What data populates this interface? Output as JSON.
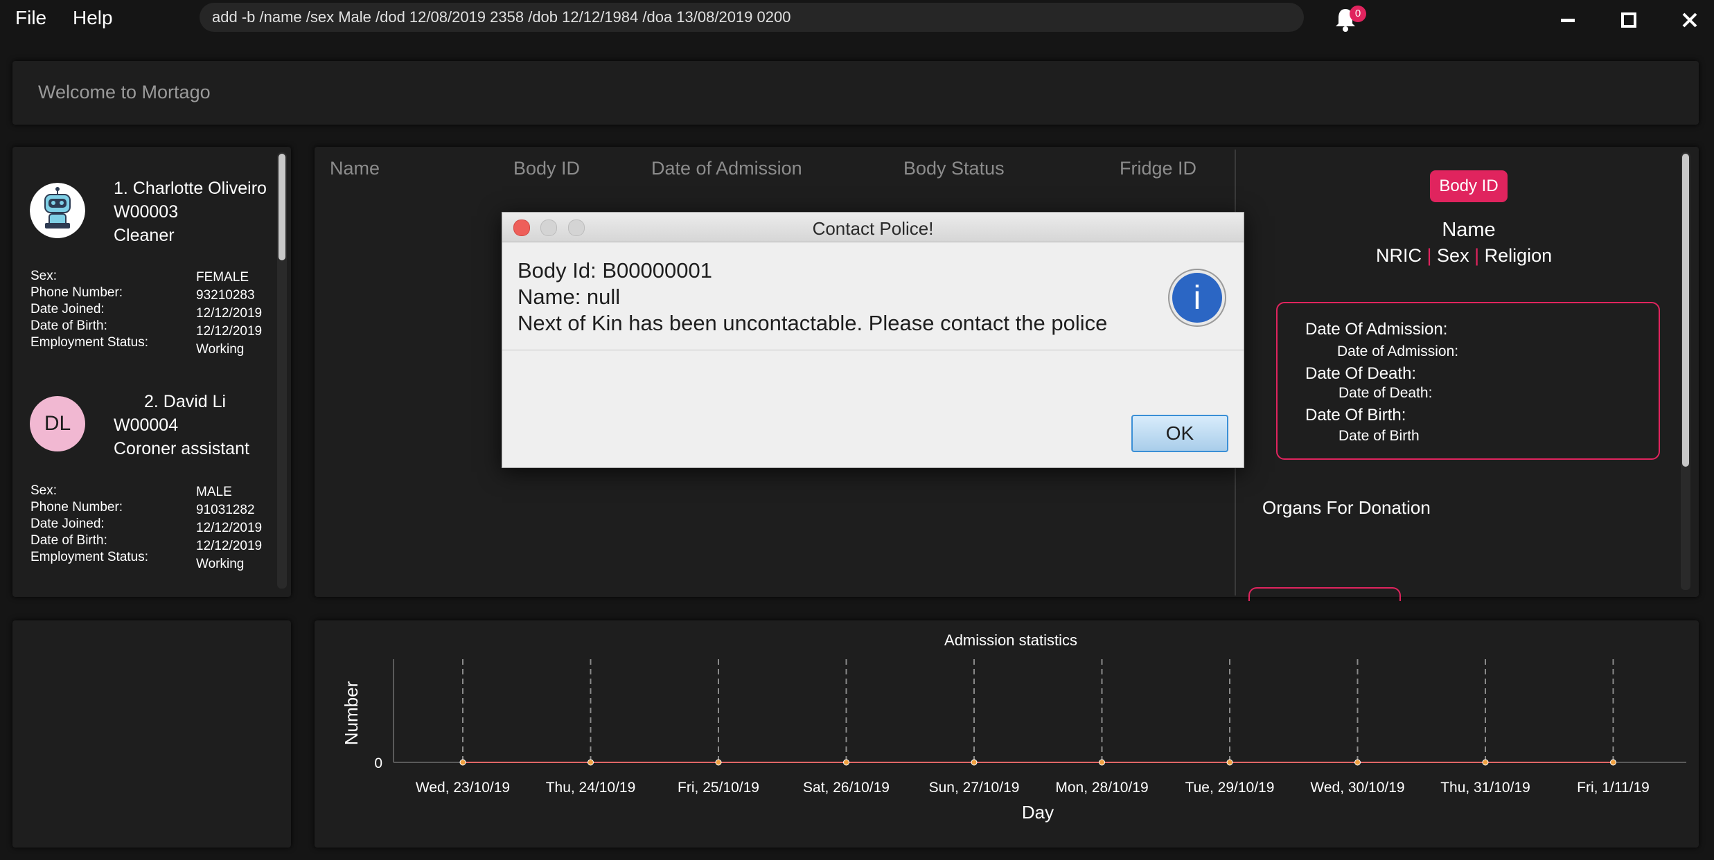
{
  "menu": {
    "file": "File",
    "help": "Help"
  },
  "command": {
    "text": "add -b /name /sex Male /dod 12/08/2019 2358 /dob 12/12/1984 /doa 13/08/2019 0200"
  },
  "notifications": {
    "count": "0"
  },
  "welcome": {
    "text": "Welcome to Mortago"
  },
  "workers": [
    {
      "title": "1. Charlotte Oliveiro",
      "id": "W00003",
      "role": "Cleaner",
      "avatar_type": "robot-icon",
      "fields": [
        {
          "label": "Sex:",
          "value": "FEMALE"
        },
        {
          "label": "Phone Number:",
          "value": "93210283"
        },
        {
          "label": "Date Joined:",
          "value": "12/12/2019"
        },
        {
          "label": "Date of Birth:",
          "value": "12/12/2019"
        },
        {
          "label": "Employment Status:",
          "value": "Working"
        }
      ]
    },
    {
      "title": "2. David Li",
      "id": "W00004",
      "role": "Coroner assistant",
      "initials": "DL",
      "fields": [
        {
          "label": "Sex:",
          "value": "MALE"
        },
        {
          "label": "Phone Number:",
          "value": "91031282"
        },
        {
          "label": "Date Joined:",
          "value": "12/12/2019"
        },
        {
          "label": "Date of Birth:",
          "value": "12/12/2019"
        },
        {
          "label": "Employment Status:",
          "value": "Working"
        }
      ]
    }
  ],
  "body_table": {
    "columns": [
      "Name",
      "Body ID",
      "Date of Admission",
      "Body Status",
      "Fridge ID"
    ]
  },
  "body_detail": {
    "badge": "Body ID",
    "name": "Name",
    "nric": "NRIC",
    "sex": "Sex",
    "religion": "Religion",
    "sep": "|",
    "doa_label": "Date Of Admission:",
    "doa_value": "Date of Admission:",
    "dod_label": "Date Of Death:",
    "dod_value": "Date of Death:",
    "dob_label": "Date Of Birth:",
    "dob_value": "Date of Birth",
    "organs_label": "Organs For Donation"
  },
  "dialog": {
    "title": "Contact Police!",
    "line1": "Body Id: B00000001",
    "line2": "Name: null",
    "line3": "Next of Kin has been uncontactable. Please contact the police",
    "ok": "OK",
    "info_icon_glyph": "i"
  },
  "chart_data": {
    "type": "line",
    "title": "Admission statistics",
    "xlabel": "Day",
    "ylabel": "Number",
    "categories": [
      "Wed, 23/10/19",
      "Thu, 24/10/19",
      "Fri, 25/10/19",
      "Sat, 26/10/19",
      "Sun, 27/10/19",
      "Mon, 28/10/19",
      "Tue, 29/10/19",
      "Wed, 30/10/19",
      "Thu, 31/10/19",
      "Fri, 1/11/19"
    ],
    "series": [
      {
        "values": [
          0,
          0,
          0,
          0,
          0,
          0,
          0,
          0,
          0,
          0
        ]
      }
    ],
    "yticks": [
      "0"
    ],
    "grid": "vertical-dashed",
    "line_color": "#e06666",
    "point_color": "#f0a040"
  },
  "colors": {
    "accent": "#e0245e",
    "background": "#151515",
    "panel": "#1e1e1e"
  }
}
